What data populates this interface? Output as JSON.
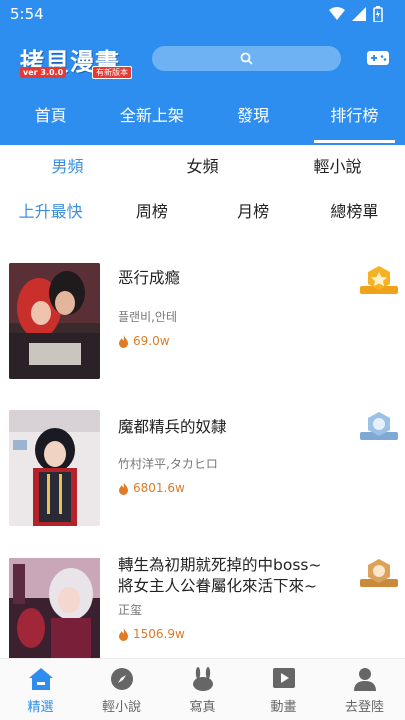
{
  "status": {
    "time": "5:54"
  },
  "header": {
    "logo_text": "拷貝漫畫",
    "logo_version": "ver 3.0.0",
    "logo_badge": "有新版本",
    "search_icon": "search-icon",
    "game_icon": "gamepad-icon"
  },
  "main_tabs": [
    {
      "label": "首頁"
    },
    {
      "label": "全新上架"
    },
    {
      "label": "發現"
    },
    {
      "label": "排行榜"
    }
  ],
  "categories": [
    {
      "label": "男頻"
    },
    {
      "label": "女頻"
    },
    {
      "label": "輕小說"
    }
  ],
  "rank_types": [
    {
      "label": "上升最快"
    },
    {
      "label": "周榜"
    },
    {
      "label": "月榜"
    },
    {
      "label": "總榜單"
    }
  ],
  "items": [
    {
      "title": "恶行成瘾",
      "author": "플랜비,안테",
      "heat": "69.0w",
      "rank": 1,
      "badge_color": "#f5b324"
    },
    {
      "title": "魔都精兵的奴隸",
      "author": "竹村洋平,タカヒロ",
      "heat": "6801.6w",
      "rank": 2,
      "badge_color": "#8fb6dc"
    },
    {
      "title": "轉生為初期就死掉的中boss~將女主人公眷屬化來活下來~",
      "author": "正玺",
      "heat": "1506.9w",
      "rank": 3,
      "badge_color": "#d99a4c"
    }
  ],
  "bottom_nav": [
    {
      "label": "精選",
      "icon": "home-icon"
    },
    {
      "label": "輕小說",
      "icon": "compass-icon"
    },
    {
      "label": "寫真",
      "icon": "rabbit-icon"
    },
    {
      "label": "動畫",
      "icon": "play-icon"
    },
    {
      "label": "去登陸",
      "icon": "user-icon"
    }
  ],
  "colors": {
    "primary": "#2e8ef0",
    "active_text": "#3d8fe0",
    "heat": "#d97b2b"
  }
}
